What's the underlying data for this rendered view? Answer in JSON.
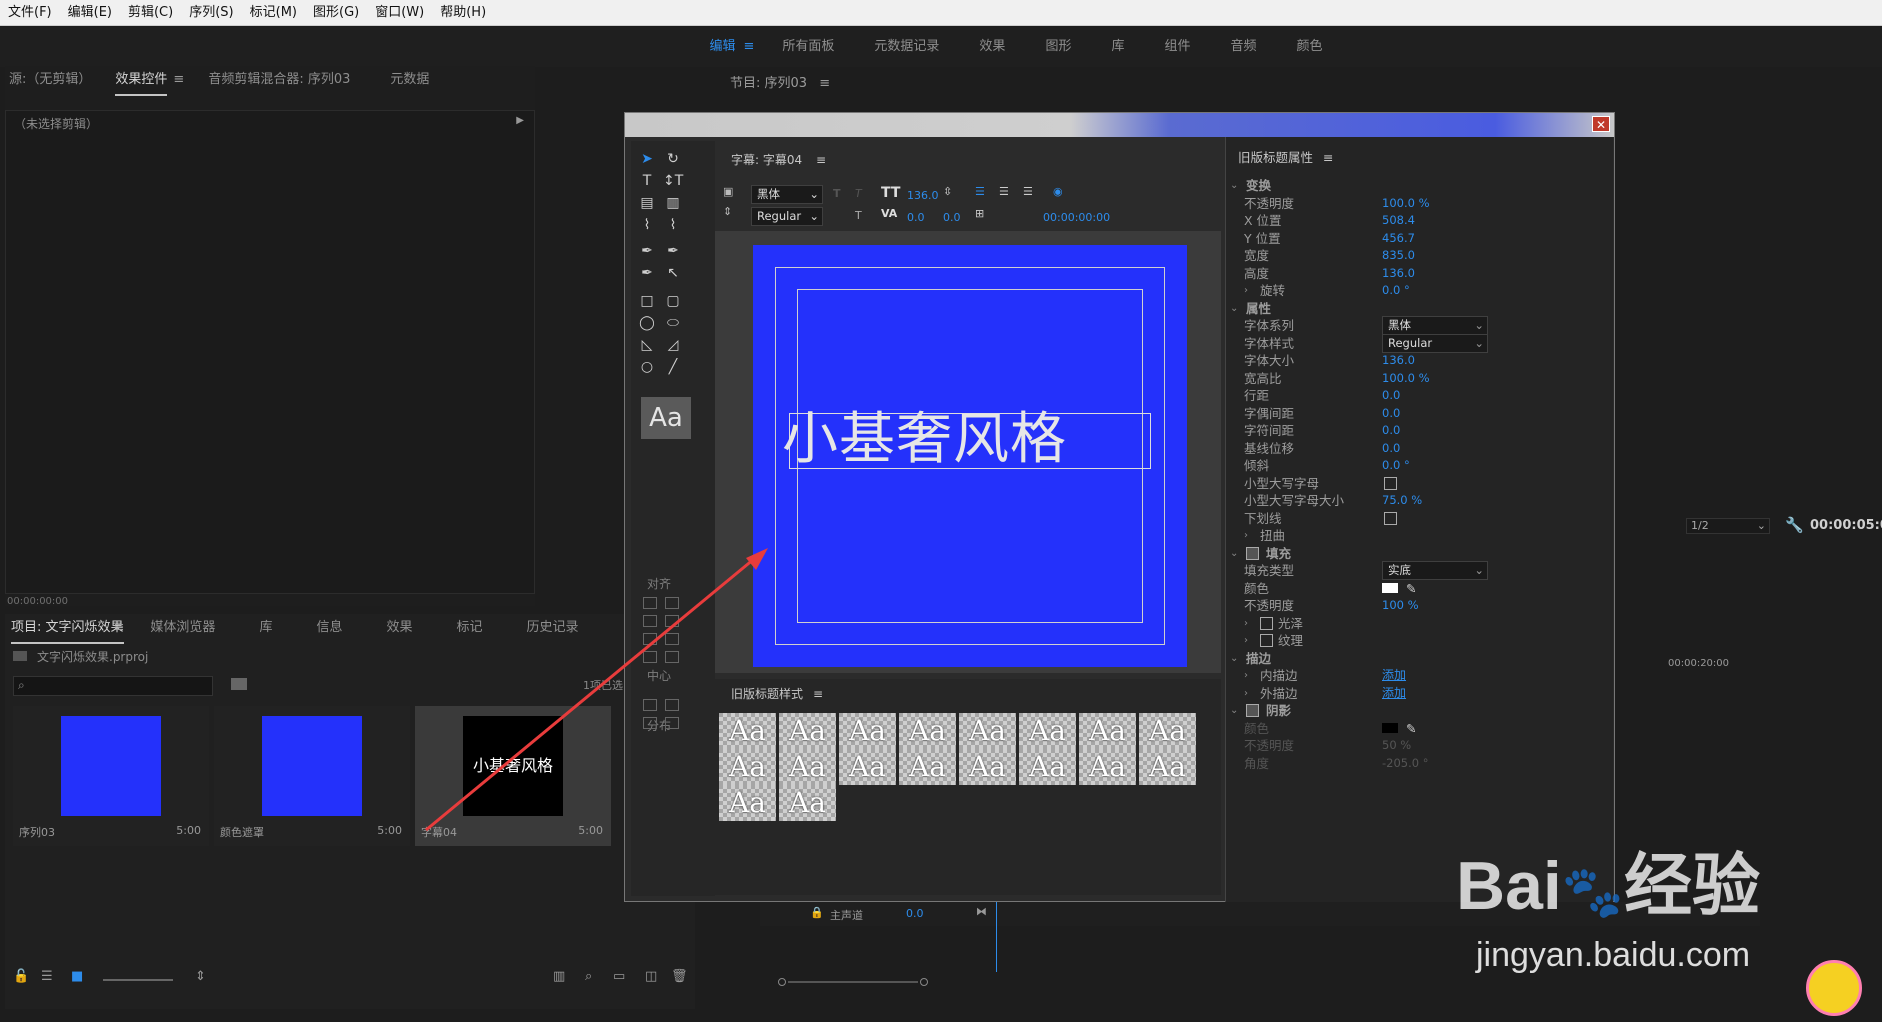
{
  "menu": [
    "文件(F)",
    "编辑(E)",
    "剪辑(C)",
    "序列(S)",
    "标记(M)",
    "图形(G)",
    "窗口(W)",
    "帮助(H)"
  ],
  "workspaces": [
    "编辑",
    "所有面板",
    "元数据记录",
    "效果",
    "图形",
    "库",
    "组件",
    "音频",
    "颜色"
  ],
  "source_tabs": [
    "源:（无剪辑）",
    "效果控件",
    "音频剪辑混合器: 序列03",
    "元数据"
  ],
  "no_clip": "（未选择剪辑）",
  "source_timecode": "00:00:00:00",
  "program_title": "节目: 序列03",
  "project": {
    "tabs": [
      "项目: 文字闪烁效果",
      "媒体浏览器",
      "库",
      "信息",
      "效果",
      "标记",
      "历史记录"
    ],
    "file": "文字闪烁效果.prproj",
    "selected": "1项已选",
    "items": [
      {
        "name": "序列03",
        "dur": "5:00",
        "color": "#2431fb"
      },
      {
        "name": "颜色遮罩",
        "dur": "5:00",
        "color": "#2431fb"
      },
      {
        "name": "字幕04",
        "dur": "5:00",
        "color": "#000000",
        "text": "小基奢风格"
      }
    ]
  },
  "right": {
    "zoom": "1/2",
    "timecode": "00:00:05:0",
    "ruler": "00:00:20:00"
  },
  "track": {
    "name": "主声道",
    "value": "0.0"
  },
  "titler": {
    "title": "字幕: 字幕04",
    "font": "黑体",
    "style": "Regular",
    "size": "136.0",
    "tracking": "0.0",
    "leading": "0.0",
    "tc": "00:00:00:00",
    "text": "小基奢风格",
    "bg": "#2431fb",
    "align_label": "对齐",
    "center_label": "中心",
    "distribute_label": "分布",
    "styles_title": "旧版标题样式",
    "styles": [
      "Aa",
      "Aa",
      "Aa",
      "Aa",
      "Aa",
      "Aa",
      "Aa",
      "Aa",
      "Aa"
    ]
  },
  "props": {
    "title": "旧版标题属性",
    "transform": "变换",
    "rows1": [
      [
        "不透明度",
        "100.0 %"
      ],
      [
        "X 位置",
        "508.4"
      ],
      [
        "Y 位置",
        "456.7"
      ],
      [
        "宽度",
        "835.0"
      ],
      [
        "高度",
        "136.0"
      ]
    ],
    "rotate": [
      "旋转",
      "0.0 °"
    ],
    "attrs": "属性",
    "font_family": [
      "字体系列",
      "黑体"
    ],
    "font_style": [
      "字体样式",
      "Regular"
    ],
    "rows2": [
      [
        "字体大小",
        "136.0"
      ],
      [
        "宽高比",
        "100.0 %"
      ],
      [
        "行距",
        "0.0"
      ],
      [
        "字偶间距",
        "0.0"
      ],
      [
        "字符间距",
        "0.0"
      ],
      [
        "基线位移",
        "0.0"
      ],
      [
        "倾斜",
        "0.0 °"
      ]
    ],
    "smallcaps": "小型大写字母",
    "smallcaps_size": [
      "小型大写字母大小",
      "75.0 %"
    ],
    "underline": "下划线",
    "distort": "扭曲",
    "fill": "填充",
    "fill_type": [
      "填充类型",
      "实底"
    ],
    "color": "颜色",
    "fill_opacity": [
      "不透明度",
      "100 %"
    ],
    "sheen": "光泽",
    "texture": "纹理",
    "stroke": "描边",
    "inner": [
      "内描边",
      "添加"
    ],
    "outer": [
      "外描边",
      "添加"
    ],
    "shadow": "阴影",
    "shadow_color": "颜色",
    "shadow_opacity": [
      "不透明度",
      "50 %"
    ],
    "shadow_angle": [
      "角度",
      "-205.0 °"
    ]
  },
  "watermark": {
    "logo": "Bai",
    "logo2": "经验",
    "url": "jingyan.baidu.com"
  }
}
